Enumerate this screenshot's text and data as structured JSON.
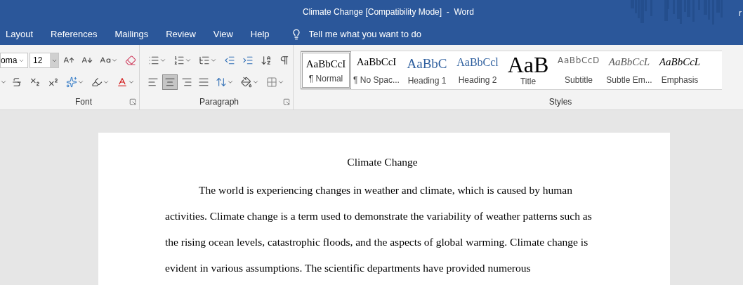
{
  "window": {
    "title": "Climate Change [Compatibility Mode]  -  Word",
    "user": "r"
  },
  "menu_tabs": [
    {
      "label": "Layout",
      "selected": false
    },
    {
      "label": "References",
      "selected": false
    },
    {
      "label": "Mailings",
      "selected": false
    },
    {
      "label": "Review",
      "selected": false
    },
    {
      "label": "View",
      "selected": false
    },
    {
      "label": "Help",
      "selected": false
    }
  ],
  "tell_me": {
    "placeholder": "Tell me what you want to do"
  },
  "font_group": {
    "label": "Font",
    "font_name": "oma",
    "font_size": "12"
  },
  "paragraph_group": {
    "label": "Paragraph",
    "alignments": [
      {
        "kind": "left",
        "selected": false
      },
      {
        "kind": "center",
        "selected": true
      },
      {
        "kind": "right",
        "selected": false
      },
      {
        "kind": "justify",
        "selected": false
      }
    ]
  },
  "styles_group": {
    "label": "Styles",
    "styles": [
      {
        "kind": "normal",
        "sample": "AaBbCcI",
        "label": "¶ Normal",
        "selected": true
      },
      {
        "kind": "plain",
        "sample": "AaBbCcI",
        "label": "¶ No Spac...",
        "selected": false
      },
      {
        "kind": "heading1",
        "sample": "AaBbC",
        "label": "Heading 1",
        "selected": false
      },
      {
        "kind": "heading2",
        "sample": "AaBbCcl",
        "label": "Heading 2",
        "selected": false
      },
      {
        "kind": "title",
        "sample": "AaB",
        "label": "Title",
        "selected": false
      },
      {
        "kind": "subtitle",
        "sample": "AaBbCcD",
        "label": "Subtitle",
        "selected": false
      },
      {
        "kind": "subtle",
        "sample": "AaBbCcL",
        "label": "Subtle Em...",
        "selected": false
      },
      {
        "kind": "emphasis",
        "sample": "AaBbCcL",
        "label": "Emphasis",
        "selected": false
      }
    ]
  },
  "document": {
    "title": "Climate Change",
    "paragraph": "The world is experiencing changes in weather and climate, which is caused by human activities. Climate change is a term used to demonstrate the variability of weather patterns such as the rising ocean levels, catastrophic floods, and the aspects of global warming. Climate change is evident in various assumptions. The scientific departments have provided numerous"
  }
}
